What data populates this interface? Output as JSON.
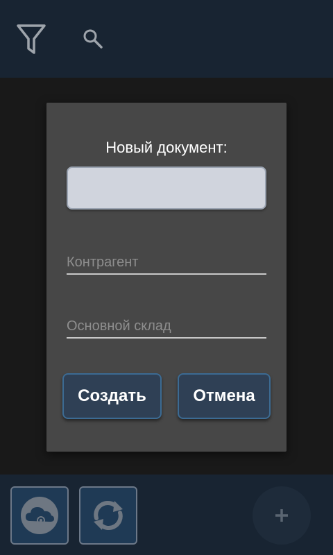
{
  "toolbar": {
    "filter_icon": "filter-icon",
    "search_icon": "search-icon"
  },
  "dialog": {
    "title": "Новый документ:",
    "document_name": {
      "value": "",
      "placeholder": ""
    },
    "contractor_field": {
      "placeholder": "Контрагент"
    },
    "warehouse_field": {
      "placeholder": "Основной склад"
    },
    "create_label": "Создать",
    "cancel_label": "Отмена"
  },
  "bottom_bar": {
    "cloud_sync_icon": "cloud-sync-icon",
    "refresh_icon": "refresh-icon",
    "add_icon": "plus-icon"
  },
  "colors": {
    "bar_background": "#182432",
    "dialog_background": "#474747",
    "button_background": "#2f4055",
    "button_border": "#3c6b93"
  }
}
